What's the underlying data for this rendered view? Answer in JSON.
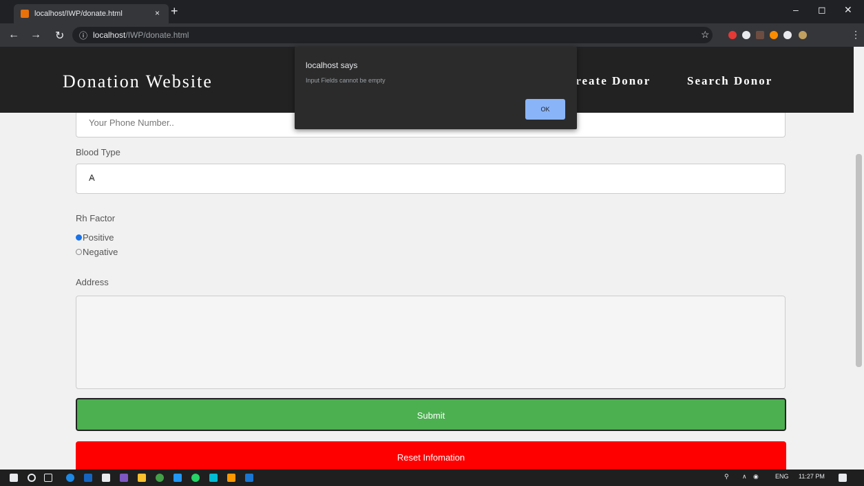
{
  "browser": {
    "tab_title": "localhost/IWP/donate.html",
    "tab_close": "×",
    "new_tab": "+",
    "url_host": "localhost",
    "url_path": "/IWP/donate.html",
    "win_min": "–",
    "win_max": "◻",
    "win_close": "✕"
  },
  "site": {
    "brand": "Donation Website",
    "nav": [
      "Create Donor",
      "Search Donor"
    ]
  },
  "form": {
    "phone_placeholder": "Your Phone Number..",
    "blood_type_label": "Blood Type",
    "blood_type_value": "A",
    "rh_label": "Rh Factor",
    "rh_options": [
      "Positive",
      "Negative"
    ],
    "rh_selected": "Positive",
    "address_label": "Address",
    "submit_label": "Submit",
    "reset_label": "Reset Infomation"
  },
  "dialog": {
    "title": "localhost says",
    "message": "Input Fields cannot be empty",
    "ok_label": "OK"
  },
  "taskbar": {
    "lang": "ENG",
    "time": "11:27 PM"
  },
  "colors": {
    "submit": "#4caf50",
    "reset": "#ff0000",
    "header": "#222222"
  }
}
